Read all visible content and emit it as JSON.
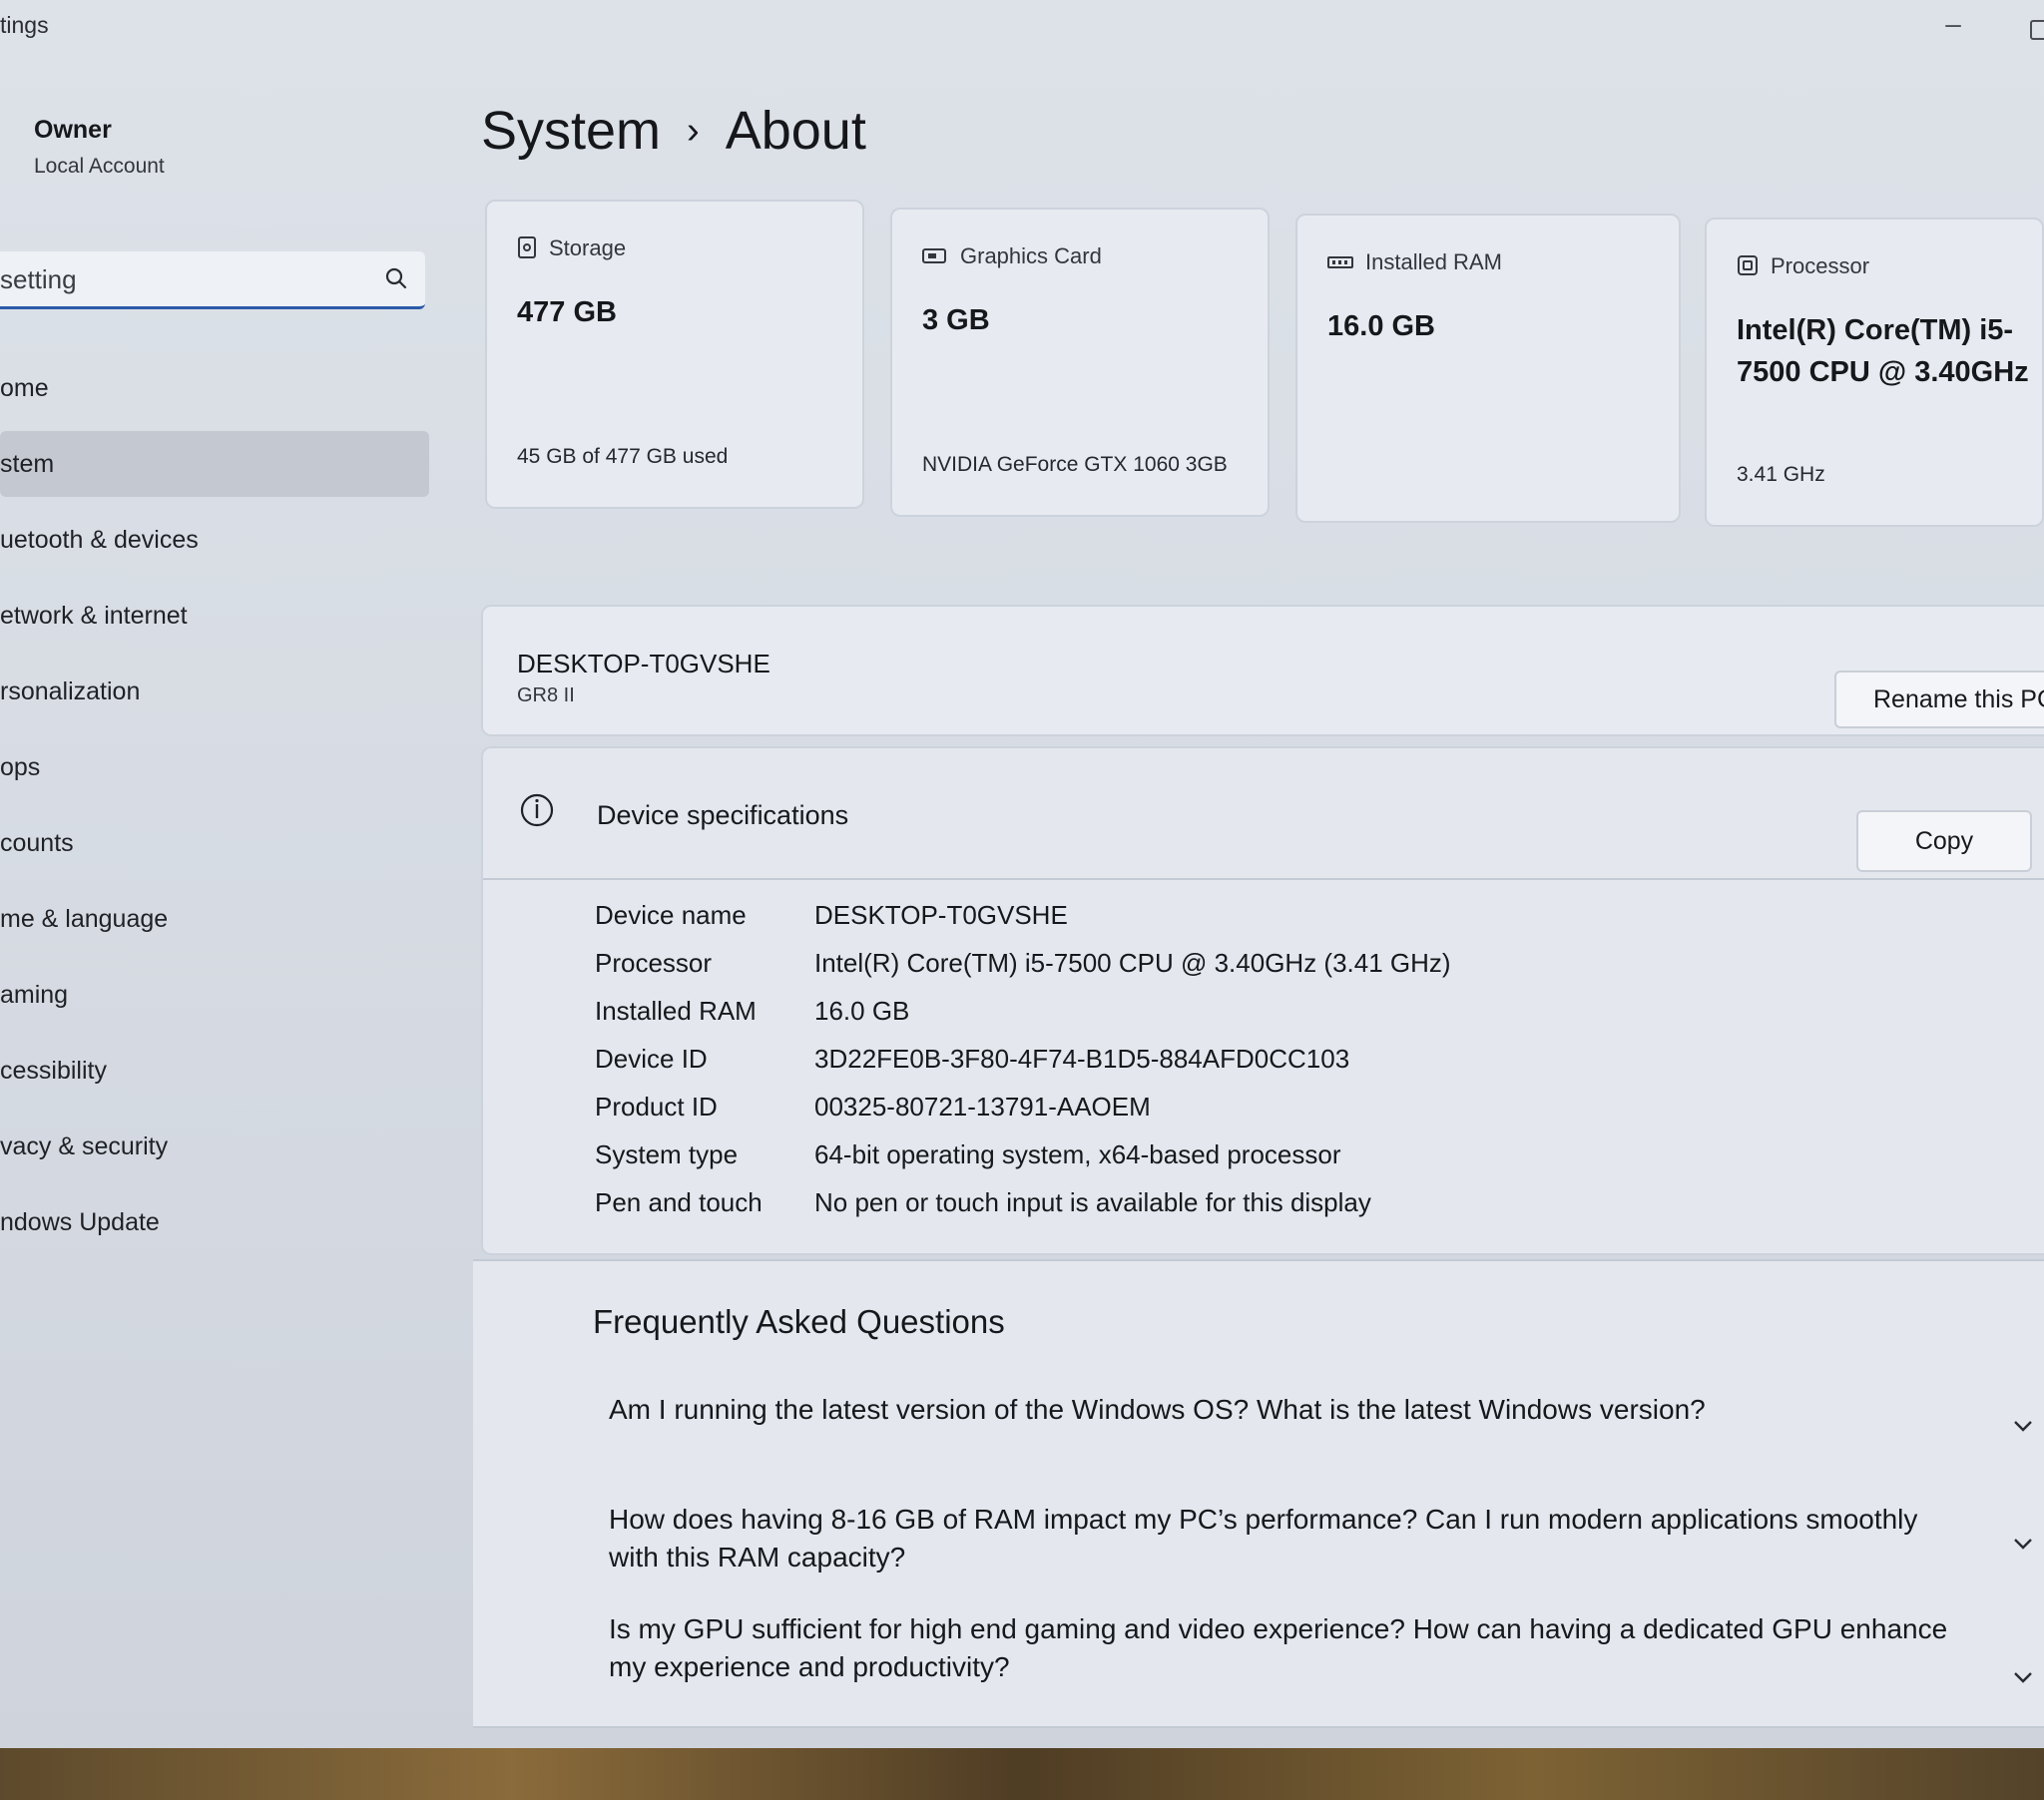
{
  "window": {
    "title": "tings"
  },
  "account": {
    "name": "Owner",
    "type": "Local Account"
  },
  "search": {
    "placeholder": "setting"
  },
  "nav": {
    "items": [
      {
        "label": "ome"
      },
      {
        "label": "stem"
      },
      {
        "label": "uetooth & devices"
      },
      {
        "label": "etwork & internet"
      },
      {
        "label": "rsonalization"
      },
      {
        "label": "ops"
      },
      {
        "label": "counts"
      },
      {
        "label": "me & language"
      },
      {
        "label": "aming"
      },
      {
        "label": "cessibility"
      },
      {
        "label": "vacy & security"
      },
      {
        "label": "ndows Update"
      }
    ],
    "active_index": 1
  },
  "breadcrumb": {
    "parent": "System",
    "separator": "›",
    "current": "About"
  },
  "cards": {
    "storage": {
      "label": "Storage",
      "value": "477 GB",
      "sub": "45 GB of 477 GB used",
      "icon": "storage-icon"
    },
    "graphics": {
      "label": "Graphics Card",
      "value": "3 GB",
      "sub": "NVIDIA GeForce GTX 1060 3GB",
      "icon": "graphics-card-icon"
    },
    "ram": {
      "label": "Installed RAM",
      "value": "16.0 GB",
      "sub": "",
      "icon": "ram-icon"
    },
    "processor": {
      "label": "Processor",
      "value": "Intel(R) Core(TM) i5-7500 CPU @ 3.40GHz",
      "sub": "3.41 GHz",
      "icon": "processor-icon"
    }
  },
  "device": {
    "name": "DESKTOP-T0GVSHE",
    "model": "GR8 II",
    "rename_label": "Rename this PC"
  },
  "specs": {
    "title": "Device specifications",
    "copy_label": "Copy",
    "rows": [
      {
        "key": "Device name",
        "value": "DESKTOP-T0GVSHE"
      },
      {
        "key": "Processor",
        "value": "Intel(R) Core(TM) i5-7500 CPU @ 3.40GHz (3.41 GHz)"
      },
      {
        "key": "Installed RAM",
        "value": "16.0 GB"
      },
      {
        "key": "Device ID",
        "value": "3D22FE0B-3F80-4F74-B1D5-884AFD0CC103"
      },
      {
        "key": "Product ID",
        "value": "00325-80721-13791-AAOEM"
      },
      {
        "key": "System type",
        "value": "64-bit operating system, x64-based processor"
      },
      {
        "key": "Pen and touch",
        "value": "No pen or touch input is available for this display"
      }
    ]
  },
  "faq": {
    "title": "Frequently Asked Questions",
    "items": [
      {
        "question": "Am I running the latest version of the Windows OS? What is the latest Windows version?"
      },
      {
        "question": "How does having 8-16 GB of RAM impact my PC’s performance? Can I run modern applications smoothly with this RAM capacity?"
      },
      {
        "question": "Is my GPU sufficient for high end gaming and video experience? How can having a dedicated GPU enhance my experience and productivity?"
      }
    ]
  },
  "colors": {
    "accent": "#2c5aa8",
    "background": "#d5dae2",
    "card": "#e7ebf1",
    "active_nav": "#c3c8d1"
  }
}
